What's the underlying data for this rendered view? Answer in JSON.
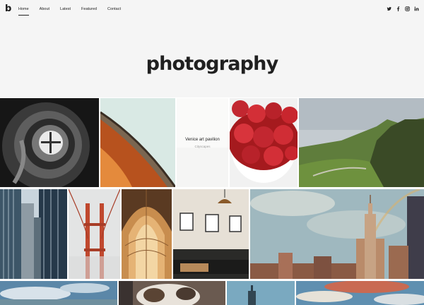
{
  "brand": {
    "logo": "b"
  },
  "nav": {
    "items": [
      "Home",
      "About",
      "Latest",
      "Featured",
      "Contact"
    ],
    "active": "Home"
  },
  "social": [
    "twitter-icon",
    "facebook-icon",
    "instagram-icon",
    "linkedin-icon"
  ],
  "hero": {
    "title": "photography"
  },
  "gallery": {
    "hover": {
      "title": "Venice art pavilion",
      "subtitle": "Cityscapes"
    },
    "photos": [
      "spiral-staircase",
      "curved-roof",
      "venice-art-pavilion",
      "raspberries",
      "green-hills",
      "skyscrapers",
      "golden-gate-bridge",
      "arched-ceiling",
      "cafe-interior",
      "city-skyline-rainbow",
      "sky-clouds",
      "dog",
      "tower",
      "sunset-clouds"
    ]
  }
}
